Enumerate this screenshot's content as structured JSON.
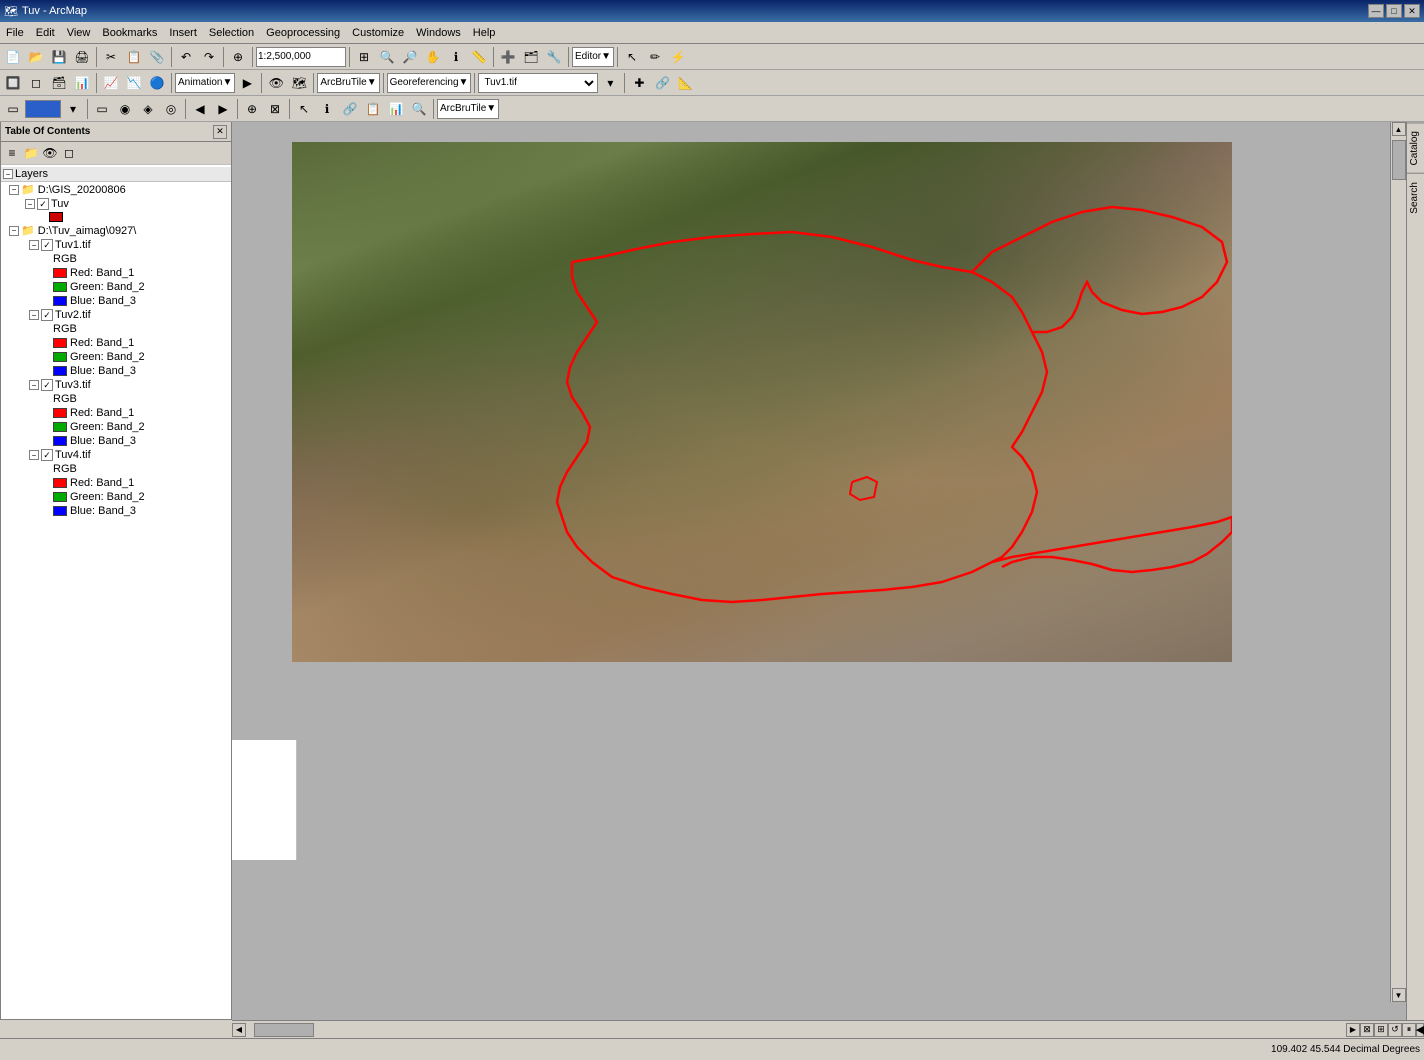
{
  "titlebar": {
    "title": "Tuv - ArcMap",
    "icon": "🗺",
    "buttons": [
      "—",
      "□",
      "✕"
    ]
  },
  "menubar": {
    "items": [
      "File",
      "Edit",
      "View",
      "Bookmarks",
      "Insert",
      "Selection",
      "Geoprocessing",
      "Customize",
      "Windows",
      "Help"
    ]
  },
  "toolbar1": {
    "scale": "1:2,500,000",
    "buttons": [
      "new",
      "open",
      "save",
      "print",
      "cut",
      "copy",
      "paste",
      "undo",
      "redo",
      "pointer"
    ]
  },
  "toolbar2": {
    "editor_label": "Editor",
    "animation_label": "Animation",
    "arcbrutile_label": "ArcBruTile",
    "georef_label": "Georeferencing",
    "tuv_tif": "Tuv1.tif"
  },
  "toc": {
    "title": "Table Of Contents",
    "sections": {
      "layers_label": "Layers",
      "folder1": "D:\\GIS_20200806",
      "layer_tuv": "Tuv",
      "folder2": "D:\\Tuv_aimag\\0927\\",
      "files": [
        {
          "name": "Tuv1.tif",
          "bands": [
            {
              "color": "#ff0000",
              "label": "Red:",
              "band": "Band_1"
            },
            {
              "color": "#00aa00",
              "label": "Green:",
              "band": "Band_2"
            },
            {
              "color": "#0000ff",
              "label": "Blue:",
              "band": "Band_3"
            }
          ]
        },
        {
          "name": "Tuv2.tif",
          "bands": [
            {
              "color": "#ff0000",
              "label": "Red:",
              "band": "Band_1"
            },
            {
              "color": "#00aa00",
              "label": "Green:",
              "band": "Band_2"
            },
            {
              "color": "#0000ff",
              "label": "Blue:",
              "band": "Band_3"
            }
          ]
        },
        {
          "name": "Tuv3.tif",
          "bands": [
            {
              "color": "#ff0000",
              "label": "Red:",
              "band": "Band_1"
            },
            {
              "color": "#00aa00",
              "label": "Green:",
              "band": "Band_2"
            },
            {
              "color": "#0000ff",
              "label": "Blue:",
              "band": "Band_3"
            }
          ]
        },
        {
          "name": "Tuv4.tif",
          "bands": [
            {
              "color": "#ff0000",
              "label": "Red:",
              "band": "Band_1"
            },
            {
              "color": "#00aa00",
              "label": "Green:",
              "band": "Band_2"
            },
            {
              "color": "#0000ff",
              "label": "Blue:",
              "band": "Band_3"
            }
          ]
        }
      ]
    }
  },
  "right_tabs": [
    "Catalog",
    "Search"
  ],
  "statusbar": {
    "coordinates": "109.402  45.544 Decimal Degrees"
  },
  "map": {
    "boundary_color": "#ff0000",
    "boundary_width": "2"
  }
}
